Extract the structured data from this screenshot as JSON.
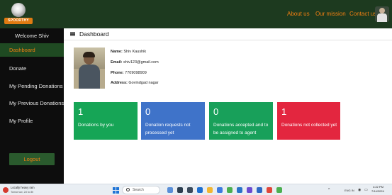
{
  "brand": {
    "logo_text": "SPOORTHY"
  },
  "nav": {
    "links": [
      "About us",
      "Our mission",
      "Contact us"
    ]
  },
  "sidebar": {
    "welcome": "Welcome Shiv",
    "items": [
      {
        "label": "Dashboard",
        "active": true
      },
      {
        "label": "Donate",
        "active": false
      },
      {
        "label": "My Pending Donations",
        "active": false
      },
      {
        "label": "My Previous Donations",
        "active": false
      },
      {
        "label": "My Profile",
        "active": false
      }
    ],
    "logout": "Logout"
  },
  "main": {
    "title": "Dashboard",
    "profile": {
      "name_label": "Name:",
      "name": "Shiv Kaushik",
      "email_label": "Email:",
      "email": "shiv123@gmail.com",
      "phone_label": "Phone:",
      "phone": "7709098909",
      "address_label": "Address:",
      "address": "Govindgad nagar"
    },
    "cards": [
      {
        "count": "1",
        "label": "Donations by you",
        "color": "#16a556"
      },
      {
        "count": "0",
        "label": "Donation requests not processed yet",
        "color": "#3f73c9"
      },
      {
        "count": "0",
        "label": "Donations accepted and to be assigned to agent",
        "color": "#18a05a"
      },
      {
        "count": "1",
        "label": "Donations not collected yet",
        "color": "#e3263f"
      }
    ]
  },
  "taskbar": {
    "weather_line1": "Locally heavy rain",
    "weather_line2": "Tomorrow, 2d to 8h",
    "search_placeholder": "Search",
    "tray_lang": "ENG IN",
    "time": "4:22 PM",
    "date": "7/14/2024"
  },
  "colors": {
    "navbar": "#1d3a1f",
    "sidebar": "#0d0d0d",
    "accent": "#f07f12",
    "active_item": "#1f4a22"
  }
}
